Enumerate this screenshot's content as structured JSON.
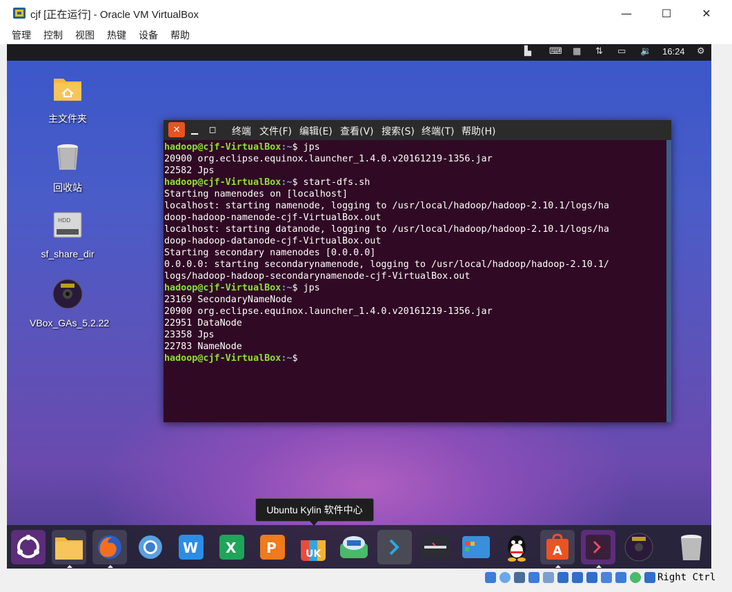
{
  "window": {
    "title": "cjf [正在运行] - Oracle VM VirtualBox",
    "minimize": "—",
    "maximize": "☐",
    "close": "✕"
  },
  "host_menu": [
    "管理",
    "控制",
    "视图",
    "热键",
    "设备",
    "帮助"
  ],
  "guest_topbar": {
    "clock": "16:24"
  },
  "desktop_icons": [
    {
      "label": "主文件夹"
    },
    {
      "label": "回收站"
    },
    {
      "label": "sf_share_dir"
    },
    {
      "label": "VBox_GAs_5.2.22"
    }
  ],
  "terminal": {
    "menu": [
      "终端",
      "文件(F)",
      "编辑(E)",
      "查看(V)",
      "搜索(S)",
      "终端(T)",
      "帮助(H)"
    ],
    "prompt_user": "hadoop@cjf-VirtualBox",
    "prompt_path": ":~",
    "lines": [
      {
        "type": "prompt",
        "cmd": "$ jps"
      },
      {
        "type": "out",
        "text": "20900 org.eclipse.equinox.launcher_1.4.0.v20161219-1356.jar"
      },
      {
        "type": "out",
        "text": "22582 Jps"
      },
      {
        "type": "prompt",
        "cmd": "$ start-dfs.sh"
      },
      {
        "type": "out",
        "text": "Starting namenodes on [localhost]"
      },
      {
        "type": "out",
        "text": "localhost: starting namenode, logging to /usr/local/hadoop/hadoop-2.10.1/logs/ha"
      },
      {
        "type": "out",
        "text": "doop-hadoop-namenode-cjf-VirtualBox.out"
      },
      {
        "type": "out",
        "text": "localhost: starting datanode, logging to /usr/local/hadoop/hadoop-2.10.1/logs/ha"
      },
      {
        "type": "out",
        "text": "doop-hadoop-datanode-cjf-VirtualBox.out"
      },
      {
        "type": "out",
        "text": "Starting secondary namenodes [0.0.0.0]"
      },
      {
        "type": "out",
        "text": "0.0.0.0: starting secondarynamenode, logging to /usr/local/hadoop/hadoop-2.10.1/"
      },
      {
        "type": "out",
        "text": "logs/hadoop-hadoop-secondarynamenode-cjf-VirtualBox.out"
      },
      {
        "type": "prompt",
        "cmd": "$ jps"
      },
      {
        "type": "out",
        "text": "23169 SecondaryNameNode"
      },
      {
        "type": "out",
        "text": "20900 org.eclipse.equinox.launcher_1.4.0.v20161219-1356.jar"
      },
      {
        "type": "out",
        "text": "22951 DataNode"
      },
      {
        "type": "out",
        "text": "23358 Jps"
      },
      {
        "type": "out",
        "text": "22783 NameNode"
      },
      {
        "type": "prompt",
        "cmd": "$"
      }
    ]
  },
  "tooltip": "Ubuntu Kylin 软件中心",
  "dock_items": [
    "ubuntu-kylin-icon",
    "files-icon",
    "firefox-icon",
    "chromium-icon",
    "word-icon",
    "excel-icon",
    "powerpoint-icon",
    "software-center-icon",
    "backup-icon",
    "vscode-icon",
    "terminal-dark-icon",
    "workspace-icon",
    "qq-icon",
    "app-store-icon",
    "terminal-icon",
    "vbox-gas-icon",
    "trash-icon"
  ],
  "statusbar": {
    "host_key": "Right Ctrl"
  },
  "colors": {
    "term_bg": "#300a24",
    "prompt_user": "#8ae234",
    "prompt_path": "#729fcf",
    "ubuntu_orange": "#e95420"
  }
}
